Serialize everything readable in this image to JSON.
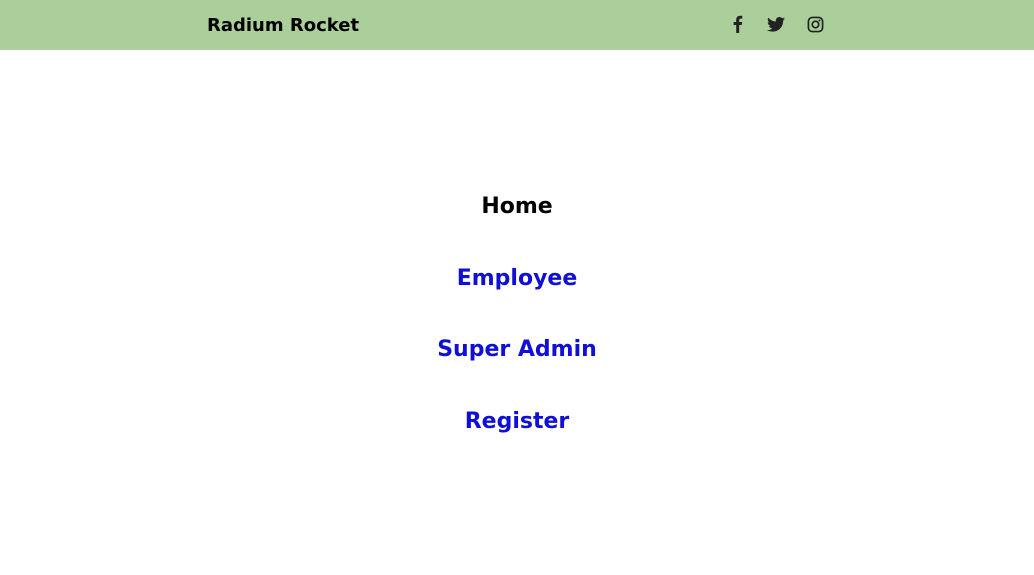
{
  "header": {
    "brand": "Radium Rocket",
    "background_color": "#abcf9b",
    "social_icons": [
      "facebook-icon",
      "twitter-icon",
      "instagram-icon"
    ]
  },
  "nav": {
    "items": [
      {
        "label": "Home",
        "active": true
      },
      {
        "label": "Employee",
        "active": false
      },
      {
        "label": "Super Admin",
        "active": false
      },
      {
        "label": "Register",
        "active": false
      }
    ],
    "link_color": "#0f0fd6",
    "active_color": "#000000"
  }
}
